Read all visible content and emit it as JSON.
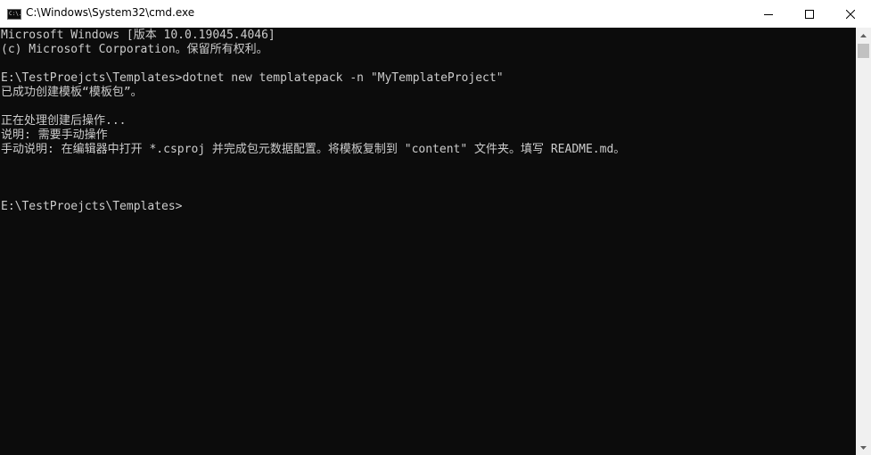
{
  "window": {
    "title": "C:\\Windows\\System32\\cmd.exe",
    "icon": "cmd-console-icon",
    "icon_text": "C:\\."
  },
  "controls": {
    "minimize_icon": "minimize-icon",
    "maximize_icon": "maximize-icon",
    "close_icon": "close-icon"
  },
  "console": {
    "lines": [
      "Microsoft Windows [版本 10.0.19045.4046]",
      "(c) Microsoft Corporation。保留所有权利。",
      "",
      "E:\\TestProejcts\\Templates>dotnet new templatepack -n \"MyTemplateProject\"",
      "已成功创建模板“模板包”。",
      "",
      "正在处理创建后操作...",
      "说明: 需要手动操作",
      "手动说明: 在编辑器中打开 *.csproj 并完成包元数据配置。将模板复制到 \"content\" 文件夹。填写 README.md。",
      "",
      "",
      "",
      "E:\\TestProejcts\\Templates>"
    ],
    "text_color": "#cccccc",
    "background": "#0c0c0c"
  },
  "scrollbar": {
    "up_icon": "scroll-up-arrow-icon",
    "down_icon": "scroll-down-arrow-icon"
  }
}
